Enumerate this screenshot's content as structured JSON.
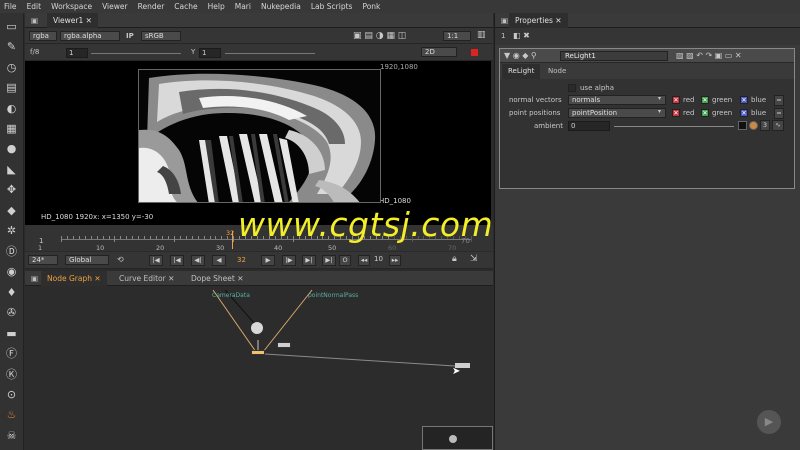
{
  "menu": [
    "File",
    "Edit",
    "Workspace",
    "Viewer",
    "Render",
    "Cache",
    "Help",
    "Mari",
    "Nukepedia",
    "Lab Scripts",
    "Ponk"
  ],
  "viewer": {
    "tab_label": "Viewer1",
    "channels": "rgba",
    "channel_alpha": "rgba.alpha",
    "ip_label": "IP",
    "colorspace": "sRGB",
    "zoom": "1:1",
    "fstop": "f/8",
    "gain": "1",
    "gamma_label": "Y",
    "gamma": "1",
    "view_mode": "2D",
    "frame_size_label": "1920,1080",
    "format_label": "HD_1080",
    "status": "HD_1080 1920x:  x=1350 y=-30"
  },
  "timeline": {
    "start": "1",
    "end": "70",
    "current": "32",
    "ticks": [
      "1",
      "10",
      "20",
      "30",
      "40",
      "50",
      "60",
      "70"
    ],
    "fps": "24*",
    "scope": "Global",
    "increment": "10",
    "current_field": "32"
  },
  "graph_tabs": [
    "Node Graph",
    "Curve Editor",
    "Dope Sheet"
  ],
  "nodes": {
    "camera_label": "CameraData",
    "pointpass_label": "pointNormalPass"
  },
  "properties": {
    "tab_label": "Properties",
    "node_count": "1",
    "node_name": "ReLight1",
    "tabs": [
      "ReLight",
      "Node"
    ],
    "use_alpha_label": "use alpha",
    "rows": [
      {
        "label": "normal vectors",
        "value": "normals",
        "c1": "red",
        "c2": "green",
        "c3": "blue"
      },
      {
        "label": "point positions",
        "value": "pointPosition",
        "c1": "red",
        "c2": "green",
        "c3": "blue"
      }
    ],
    "ambient_label": "ambient",
    "ambient_value": "0",
    "ambient_count": "3"
  },
  "watermark": "www.cgtsj.com",
  "colors": {
    "accent": "#f0a040",
    "check_red": "#c8303a",
    "check_green": "#3ea04a",
    "check_blue": "#4858c8",
    "watermark": "#f2ee2a"
  }
}
